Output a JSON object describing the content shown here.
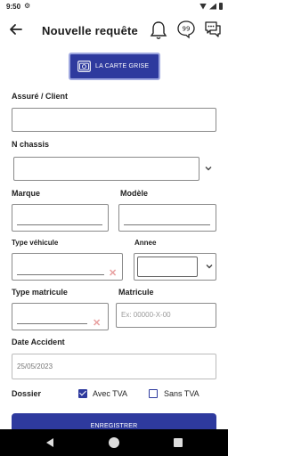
{
  "status": {
    "time": "9:50"
  },
  "header": {
    "title": "Nouvelle requête"
  },
  "carte_grise": {
    "label": "LA CARTE GRISE"
  },
  "form": {
    "assure_label": "Assuré / Client",
    "chassis_label": "N chassis",
    "marque_label": "Marque",
    "modele_label": "Modèle",
    "type_vehicule_label": "Type véhicule",
    "annee_label": "Annee",
    "type_matricule_label": "Type matricule",
    "matricule_label": "Matricule",
    "matricule_placeholder": "Ex: 00000-X-00",
    "date_accident_label": "Date Accident",
    "date_accident_value": "25/05/2023",
    "dossier_label": "Dossier",
    "avec_tva_label": "Avec TVA",
    "avec_tva_checked": true,
    "sans_tva_label": "Sans TVA",
    "sans_tva_checked": false
  },
  "actions": {
    "save_label": "ENREGISTRER"
  },
  "colors": {
    "primary": "#2e3a9e",
    "clear_icon": "#e8a0a0"
  }
}
